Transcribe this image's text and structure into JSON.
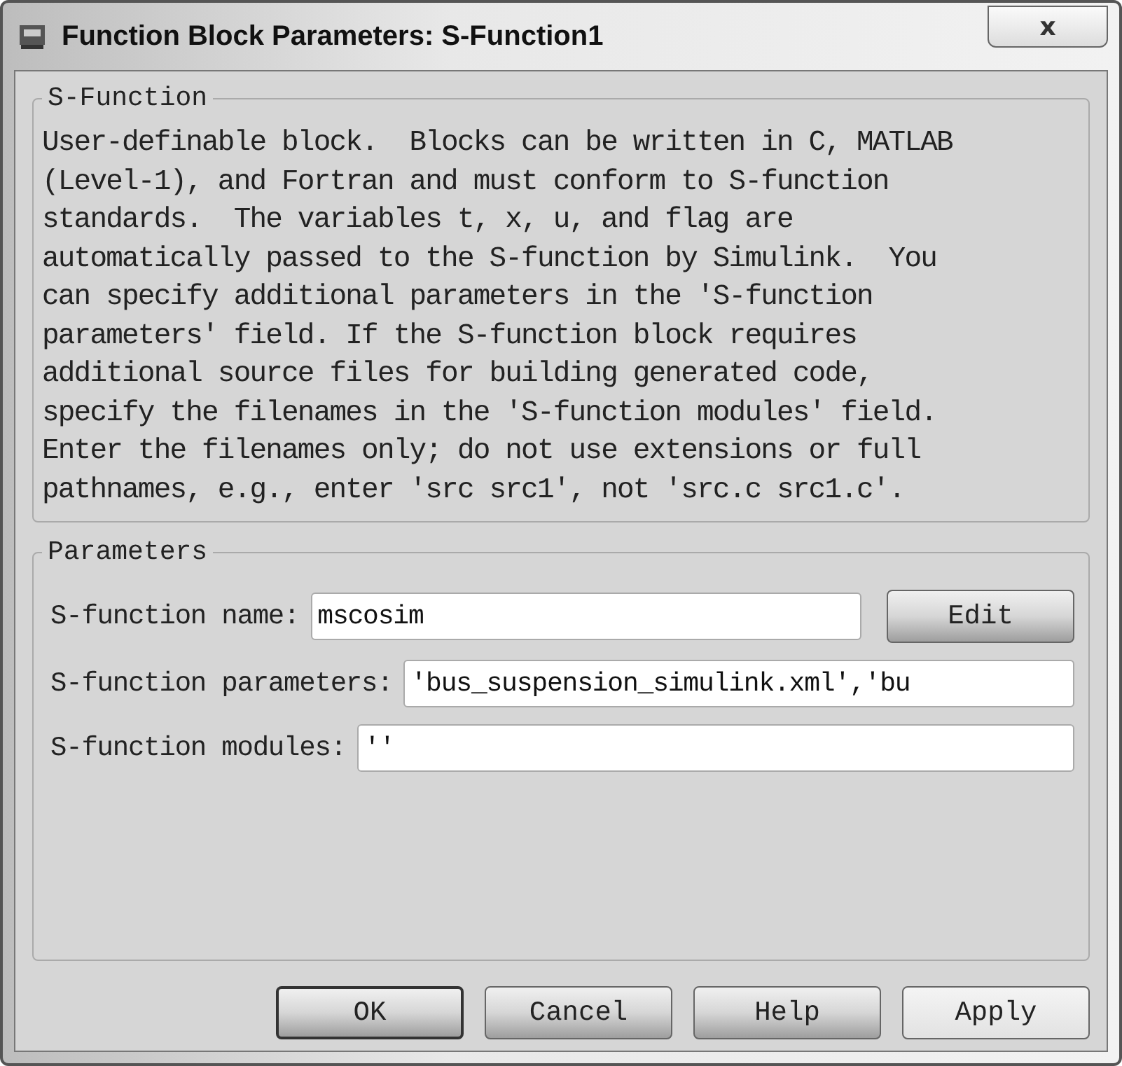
{
  "window": {
    "title": "Function Block Parameters: S-Function1",
    "close_label": "x"
  },
  "description_group": {
    "title": "S-Function",
    "text": "User-definable block.  Blocks can be written in C, MATLAB\n(Level-1), and Fortran and must conform to S-function\nstandards.  The variables t, x, u, and flag are\nautomatically passed to the S-function by Simulink.  You\ncan specify additional parameters in the 'S-function\nparameters' field. If the S-function block requires\nadditional source files for building generated code,\nspecify the filenames in the 'S-function modules' field.\nEnter the filenames only; do not use extensions or full\npathnames, e.g., enter 'src src1', not 'src.c src1.c'."
  },
  "parameters_group": {
    "title": "Parameters",
    "fields": [
      {
        "label": "S-function name:",
        "value": "mscosim",
        "button": "Edit"
      },
      {
        "label": "S-function parameters:",
        "value": "'bus_suspension_simulink.xml','bu"
      },
      {
        "label": "S-function modules:",
        "value": "''"
      }
    ]
  },
  "buttons": [
    {
      "label": "OK",
      "kind": "default"
    },
    {
      "label": "Cancel",
      "kind": "normal"
    },
    {
      "label": "Help",
      "kind": "normal"
    },
    {
      "label": "Apply",
      "kind": "flat"
    }
  ]
}
